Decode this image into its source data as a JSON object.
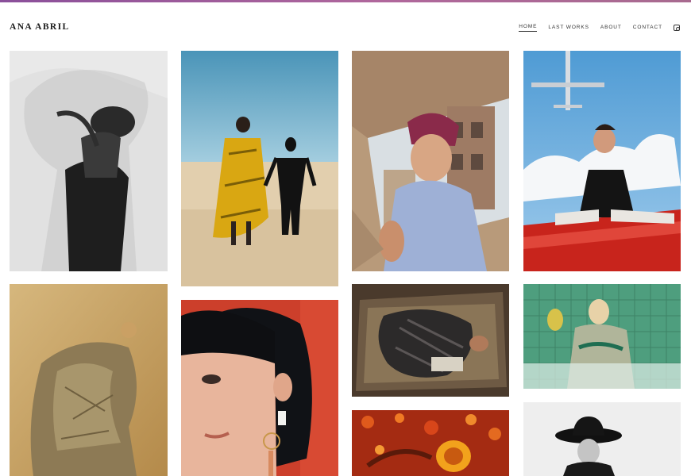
{
  "brand": {
    "name": "ANA ABRIL"
  },
  "nav": {
    "items": [
      "HOME",
      "LAST WORKS",
      "ABOUT",
      "CONTACT"
    ],
    "active": "HOME",
    "instagram_icon": "instagram-icon"
  },
  "colors": {
    "accent_bar": "#a0609c",
    "background": "#ffffff",
    "nav_text": "#333333"
  },
  "gallery": {
    "photos": [
      "bw-veil-portrait",
      "yellow-dress-desert",
      "box-view-city",
      "airplane-red-car",
      "crumpled-dress-gold",
      "bob-haircut-red",
      "lying-on-floor",
      "green-tiles-bathtub",
      "orange-flowers-floor",
      "black-hat-portrait"
    ]
  }
}
